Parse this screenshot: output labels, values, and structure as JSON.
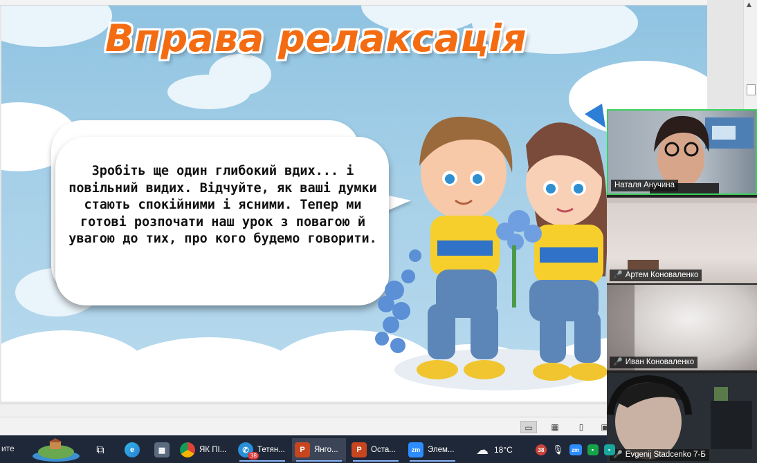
{
  "slide": {
    "title": "Вправа релаксація",
    "bubble_text": "Зробіть ще один глибокий вдих... і повільний видих. Відчуйте, як ваші думки стають спокійними і ясними. Тепер ми готові розпочати наш урок з повагою й увагою до тих, про кого будемо говорити."
  },
  "zoom": {
    "participants": [
      {
        "name": "Наталя Анучина",
        "muted": false,
        "active": true
      },
      {
        "name": "Артем Коноваленко",
        "muted": true,
        "active": false
      },
      {
        "name": "Иван Коноваленко",
        "muted": true,
        "active": false
      },
      {
        "name": "Evgenij Stadcenko 7-Б",
        "muted": true,
        "active": false
      }
    ]
  },
  "taskbar": {
    "left_fragment": "ите",
    "apps": [
      {
        "label": "ЯК ПІ...",
        "icon": "chrome-icon"
      },
      {
        "label": "Тетян...",
        "icon": "messenger-icon",
        "badge": "38"
      },
      {
        "label": "Янго...",
        "icon": "powerpoint-icon",
        "active": true
      },
      {
        "label": "Оста...",
        "icon": "powerpoint-icon"
      },
      {
        "label": "Элем...",
        "icon": "zoom-icon"
      }
    ],
    "weather": "18°C",
    "tray_badge": "38"
  },
  "icons": {
    "mic_muted": "🎤",
    "view_normal": "▭",
    "view_sorter": "▦",
    "view_reading": "▯",
    "view_slideshow": "▣",
    "scroll_up": "▲",
    "task_view": "⧉",
    "calculator": "▦",
    "edge": "e",
    "powerpoint": "P",
    "zoom": "zm",
    "weather": "☁",
    "mic": "🎙",
    "tray_other": "▪"
  },
  "colors": {
    "title": "#f36c12",
    "zoom_active_border": "#3ad15a",
    "taskbar_bg": "#1f2838"
  }
}
